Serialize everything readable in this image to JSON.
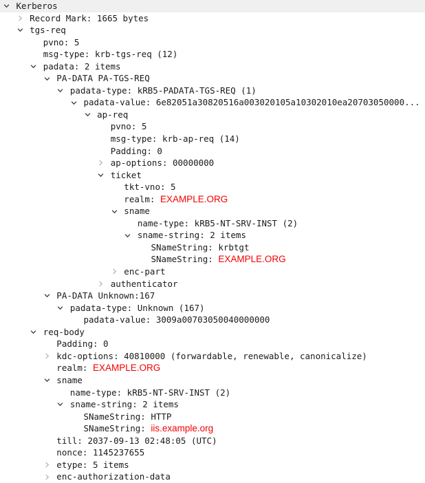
{
  "panel": {
    "name": "packet-detail-tree",
    "protocol": "Kerberos",
    "selected_row_index": 0
  },
  "colors": {
    "value_highlight": "#f40000",
    "selected_row_background": "#f0f0f0",
    "text": "#1a1a1a",
    "twisty_open": "#3c3c3c",
    "twisty_closed": "#b6b6b6"
  },
  "icons": {
    "expanded": "chevron-down-icon",
    "collapsed": "chevron-right-icon"
  },
  "rows": [
    {
      "depth": 0,
      "state": "expanded",
      "text": "Kerberos",
      "selected": true
    },
    {
      "depth": 1,
      "state": "collapsed",
      "text": "Record Mark: 1665 bytes"
    },
    {
      "depth": 1,
      "state": "expanded",
      "text": "tgs-req"
    },
    {
      "depth": 2,
      "state": "leaf",
      "text": "pvno: 5"
    },
    {
      "depth": 2,
      "state": "leaf",
      "text": "msg-type: krb-tgs-req (12)"
    },
    {
      "depth": 2,
      "state": "expanded",
      "text": "padata: 2 items"
    },
    {
      "depth": 3,
      "state": "expanded",
      "text": "PA-DATA PA-TGS-REQ"
    },
    {
      "depth": 4,
      "state": "expanded",
      "text": "padata-type: kRB5-PADATA-TGS-REQ (1)"
    },
    {
      "depth": 5,
      "state": "expanded",
      "text": "padata-value: 6e82051a30820516a003020105a10302010ea20703050000..."
    },
    {
      "depth": 6,
      "state": "expanded",
      "text": "ap-req"
    },
    {
      "depth": 7,
      "state": "leaf",
      "text": "pvno: 5"
    },
    {
      "depth": 7,
      "state": "leaf",
      "text": "msg-type: krb-ap-req (14)"
    },
    {
      "depth": 7,
      "state": "leaf",
      "text": "Padding: 0"
    },
    {
      "depth": 7,
      "state": "collapsed",
      "text": "ap-options: 00000000"
    },
    {
      "depth": 7,
      "state": "expanded",
      "text": "ticket"
    },
    {
      "depth": 8,
      "state": "leaf",
      "text": "tkt-vno: 5"
    },
    {
      "depth": 8,
      "state": "leaf",
      "text": "realm: ",
      "red": "EXAMPLE.ORG"
    },
    {
      "depth": 8,
      "state": "expanded",
      "text": "sname"
    },
    {
      "depth": 9,
      "state": "leaf",
      "text": "name-type: kRB5-NT-SRV-INST (2)"
    },
    {
      "depth": 9,
      "state": "expanded",
      "text": "sname-string: 2 items"
    },
    {
      "depth": 10,
      "state": "leaf",
      "text": "SNameString: krbtgt"
    },
    {
      "depth": 10,
      "state": "leaf",
      "text": "SNameString: ",
      "red": "EXAMPLE.ORG"
    },
    {
      "depth": 8,
      "state": "collapsed",
      "text": "enc-part"
    },
    {
      "depth": 7,
      "state": "collapsed",
      "text": "authenticator"
    },
    {
      "depth": 3,
      "state": "expanded",
      "text": "PA-DATA Unknown:167"
    },
    {
      "depth": 4,
      "state": "expanded",
      "text": "padata-type: Unknown (167)"
    },
    {
      "depth": 5,
      "state": "leaf",
      "text": "padata-value: 3009a00703050040000000"
    },
    {
      "depth": 2,
      "state": "expanded",
      "text": "req-body"
    },
    {
      "depth": 3,
      "state": "leaf",
      "text": "Padding: 0"
    },
    {
      "depth": 3,
      "state": "collapsed",
      "text": "kdc-options: 40810000 (forwardable, renewable, canonicalize)"
    },
    {
      "depth": 3,
      "state": "leaf",
      "text": "realm: ",
      "red": "EXAMPLE.ORG"
    },
    {
      "depth": 3,
      "state": "expanded",
      "text": "sname"
    },
    {
      "depth": 4,
      "state": "leaf",
      "text": "name-type: kRB5-NT-SRV-INST (2)"
    },
    {
      "depth": 4,
      "state": "expanded",
      "text": "sname-string: 2 items"
    },
    {
      "depth": 5,
      "state": "leaf",
      "text": "SNameString: HTTP"
    },
    {
      "depth": 5,
      "state": "leaf",
      "text": "SNameString: ",
      "red": "iis.example.org"
    },
    {
      "depth": 3,
      "state": "leaf",
      "text": "till: 2037-09-13 02:48:05 (UTC)"
    },
    {
      "depth": 3,
      "state": "leaf",
      "text": "nonce: 1145237655"
    },
    {
      "depth": 3,
      "state": "collapsed",
      "text": "etype: 5 items"
    },
    {
      "depth": 3,
      "state": "collapsed",
      "text": "enc-authorization-data"
    }
  ]
}
